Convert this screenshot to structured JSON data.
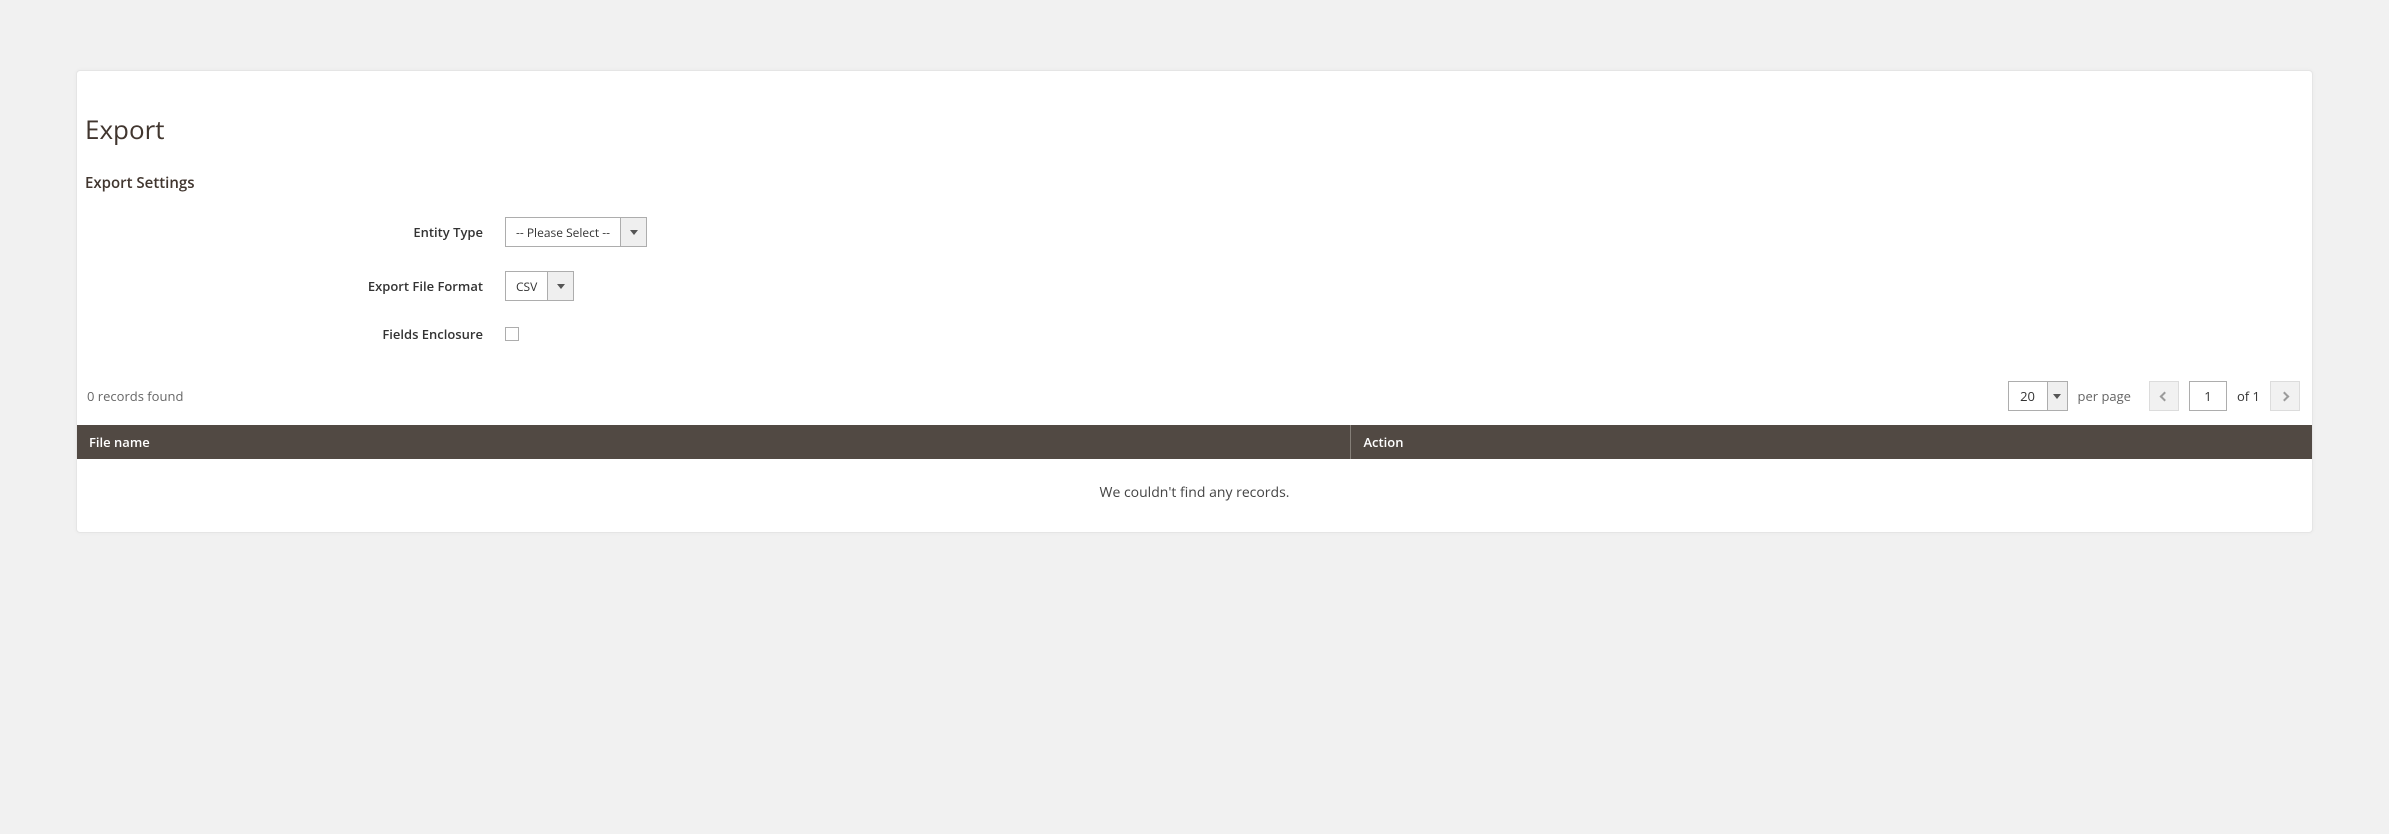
{
  "page": {
    "title": "Export",
    "section_title": "Export Settings"
  },
  "form": {
    "entity_type": {
      "label": "Entity Type",
      "value": "-- Please Select --"
    },
    "file_format": {
      "label": "Export File Format",
      "value": "CSV"
    },
    "fields_enclosure": {
      "label": "Fields Enclosure",
      "checked": false
    }
  },
  "toolbar": {
    "records_found": "0 records found",
    "per_page_value": "20",
    "per_page_label": "per page",
    "current_page": "1",
    "total_pages_label": "of 1"
  },
  "table": {
    "columns": {
      "file_name": "File name",
      "action": "Action"
    },
    "empty_message": "We couldn't find any records."
  }
}
